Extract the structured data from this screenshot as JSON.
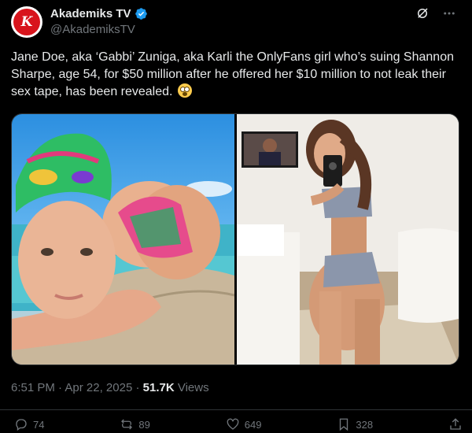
{
  "author": {
    "display_name": "Akademiks TV",
    "handle": "@AkademiksTV",
    "avatar_letter": "K",
    "verified": true
  },
  "tweet": {
    "text": "Jane Doe, aka ‘Gabbi’ Zuniga, aka Karli the OnlyFans girl who’s suing Shannon Sharpe, age 54, for $50 million after he offered her $10 million to not leak their sex tape, has been revealed.",
    "emoji": "flushed-face-emoji",
    "time": "6:51 PM",
    "date": "Apr 22, 2025",
    "separator": " · ",
    "views_count": "51.7K",
    "views_label": "Views"
  },
  "media": {
    "count": 2
  },
  "actions": {
    "replies": "74",
    "reposts": "89",
    "likes": "649",
    "bookmarks": "328"
  },
  "colors": {
    "background": "#000000",
    "text": "#e7e9ea",
    "muted": "#71767b",
    "verified": "#1d9bf0",
    "avatar": "#d8141c"
  }
}
